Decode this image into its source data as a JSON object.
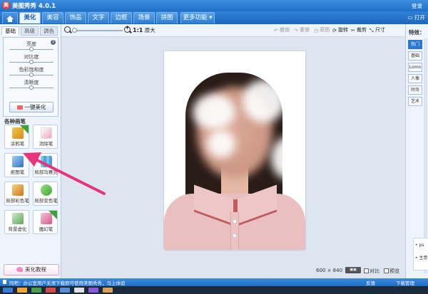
{
  "app": {
    "title": "美图秀秀 4.0.1",
    "login": "登录",
    "open": "打开"
  },
  "tabs": [
    "美化",
    "美容",
    "饰品",
    "文字",
    "边框",
    "场景",
    "拼图",
    "更多功能"
  ],
  "left": {
    "subtabs": [
      "基础",
      "高级",
      "调色"
    ],
    "sliders": [
      "亮度",
      "对比度",
      "色彩饱和度",
      "清晰度"
    ],
    "one_key": "一键美化",
    "section": "各种画笔",
    "pens": [
      "涂鸦笔",
      "消除笔",
      "抠图笔",
      "局部马赛克",
      "局部彩色笔",
      "局部变色笔",
      "背景虚化",
      "魔幻笔"
    ],
    "tutorial": "美化教程"
  },
  "toolbar": {
    "original": "1:1",
    "original_label": "原大",
    "undo": "撤销",
    "redo": "重做",
    "reset": "原图",
    "rotate": "旋转",
    "crop": "裁剪",
    "size": "尺寸"
  },
  "canvas": {
    "dims": "600 × 840",
    "compare": "对比",
    "preview": "预览"
  },
  "right": {
    "title": "特效：",
    "tabs": [
      "热门",
      "基础",
      "Lomo",
      "人像",
      "时尚",
      "艺术"
    ],
    "list": [
      "ps",
      "主意"
    ]
  },
  "status": {
    "message": "同吧：办公室用户无须下载即可使用美图秀秀，马上体验",
    "feedback": "反馈",
    "download": "下载管理"
  },
  "colors": {
    "accent": "#1f6fc8",
    "active_tab": "#2a78d0",
    "arrow": "#e8347a"
  }
}
